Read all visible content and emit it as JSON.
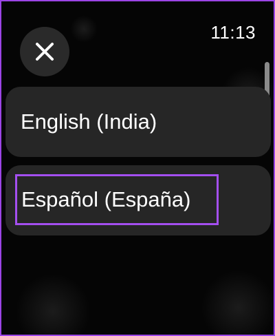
{
  "status_bar": {
    "time": "11:13"
  },
  "close_button": {
    "icon": "close-icon"
  },
  "languages": [
    {
      "label": "English (India)"
    },
    {
      "label": "Español (España)",
      "highlighted": true
    }
  ],
  "colors": {
    "frame_border": "#9c45e6",
    "highlight": "#a44ff0",
    "background": "#050505",
    "item_background": "#262626"
  }
}
